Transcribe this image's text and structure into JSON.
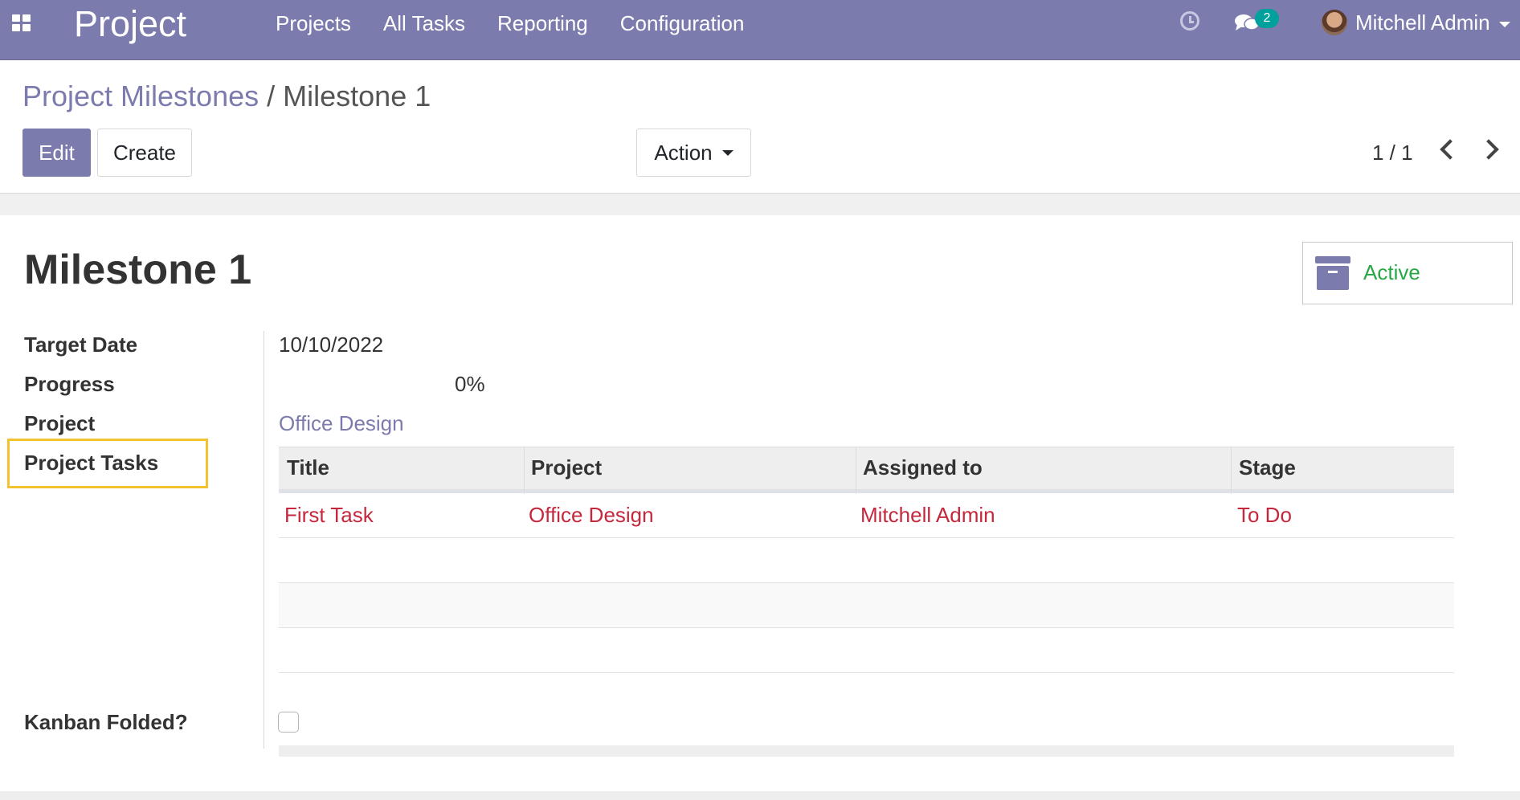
{
  "navbar": {
    "app_title": "Project",
    "menu": [
      "Projects",
      "All Tasks",
      "Reporting",
      "Configuration"
    ],
    "messages_count": "2",
    "user_name": "Mitchell Admin",
    "icons": [
      "apps-grid-icon",
      "clock-icon",
      "chat-icon",
      "avatar",
      "caret-down-icon"
    ]
  },
  "breadcrumb": {
    "parent": "Project Milestones",
    "separator": "/",
    "current": "Milestone 1"
  },
  "buttons": {
    "edit": "Edit",
    "create": "Create",
    "action": "Action"
  },
  "pager": {
    "text": "1 / 1"
  },
  "form": {
    "title": "Milestone 1",
    "active_label": "Active",
    "fields": {
      "target_date": {
        "label": "Target Date",
        "value": "10/10/2022"
      },
      "progress": {
        "label": "Progress",
        "value": "0%"
      },
      "project": {
        "label": "Project",
        "value": "Office Design"
      },
      "project_tasks": {
        "label": "Project Tasks"
      },
      "kanban_folded": {
        "label": "Kanban Folded?",
        "checked": false
      }
    },
    "tasks_table": {
      "columns": [
        "Title",
        "Project",
        "Assigned to",
        "Stage"
      ],
      "rows": [
        [
          "First Task",
          "Office Design",
          "Mitchell Admin",
          "To Do"
        ]
      ]
    }
  },
  "colors": {
    "brand": "#7c7bad",
    "active_green": "#28a745",
    "task_red": "#c5283d",
    "highlight_yellow": "#f2c230",
    "badge_teal": "#00a09d"
  }
}
